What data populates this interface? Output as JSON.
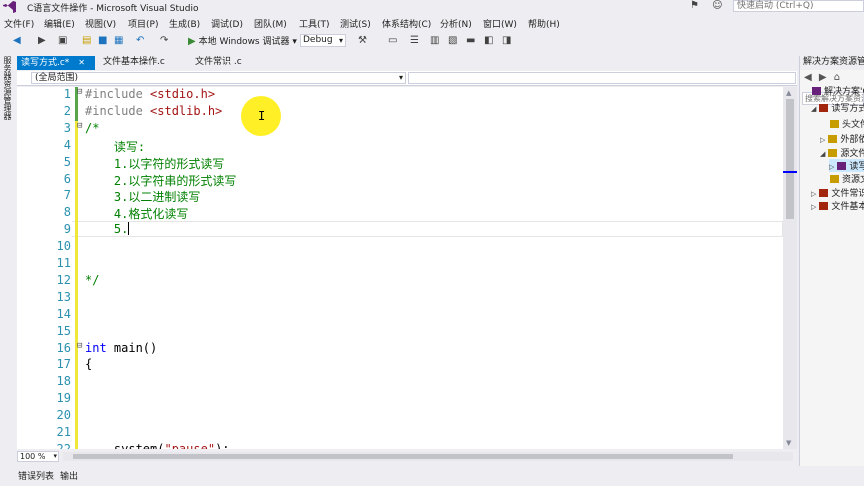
{
  "window": {
    "title": "C语言文件操作 - Microsoft Visual Studio",
    "quick_launch_placeholder": "快速启动 (Ctrl+Q)"
  },
  "menu": [
    "文件(F)",
    "编辑(E)",
    "视图(V)",
    "项目(P)",
    "生成(B)",
    "调试(D)",
    "团队(M)",
    "工具(T)",
    "测试(S)",
    "体系结构(C)",
    "分析(N)",
    "窗口(W)",
    "帮助(H)"
  ],
  "toolbar": {
    "run_label": "本地 Windows 调试器",
    "configuration": "Debug"
  },
  "left_toolwindow": "服务器资源管理器",
  "tabs": [
    {
      "label": "读写方式.c*",
      "active": true
    },
    {
      "label": "文件基本操作.c",
      "active": false
    },
    {
      "label": "文件常识 .c",
      "active": false
    }
  ],
  "nav": {
    "scope": "(全局范围)"
  },
  "editor": {
    "lines": [
      {
        "n": "1",
        "parts": [
          {
            "c": "pp",
            "t": "#include "
          },
          {
            "c": "inc",
            "t": "<stdio.h>"
          }
        ]
      },
      {
        "n": "2",
        "parts": [
          {
            "c": "pp",
            "t": "#include "
          },
          {
            "c": "inc",
            "t": "<stdlib.h>"
          }
        ]
      },
      {
        "n": "3",
        "parts": [
          {
            "c": "cm",
            "t": "/*"
          }
        ]
      },
      {
        "n": "4",
        "parts": [
          {
            "c": "cm",
            "t": "    读写:"
          }
        ]
      },
      {
        "n": "5",
        "parts": [
          {
            "c": "cm",
            "t": "    1.以字符的形式读写"
          }
        ]
      },
      {
        "n": "6",
        "parts": [
          {
            "c": "cm",
            "t": "    2.以字符串的形式读写"
          }
        ]
      },
      {
        "n": "7",
        "parts": [
          {
            "c": "cm",
            "t": "    3.以二进制读写"
          }
        ]
      },
      {
        "n": "8",
        "parts": [
          {
            "c": "cm",
            "t": "    4.格式化读写"
          }
        ]
      },
      {
        "n": "9",
        "parts": [
          {
            "c": "cm",
            "t": "    5."
          }
        ]
      },
      {
        "n": "10",
        "parts": []
      },
      {
        "n": "11",
        "parts": []
      },
      {
        "n": "12",
        "parts": [
          {
            "c": "cm",
            "t": "*/"
          }
        ]
      },
      {
        "n": "13",
        "parts": []
      },
      {
        "n": "14",
        "parts": []
      },
      {
        "n": "15",
        "parts": []
      },
      {
        "n": "16",
        "parts": [
          {
            "c": "kw",
            "t": "int"
          },
          {
            "c": "tx",
            "t": " main()"
          }
        ]
      },
      {
        "n": "17",
        "parts": [
          {
            "c": "tx",
            "t": "{"
          }
        ]
      },
      {
        "n": "18",
        "parts": []
      },
      {
        "n": "19",
        "parts": []
      },
      {
        "n": "20",
        "parts": []
      },
      {
        "n": "21",
        "parts": []
      },
      {
        "n": "22",
        "parts": [
          {
            "c": "tx",
            "t": "    system("
          },
          {
            "c": "str",
            "t": "\"pause\""
          },
          {
            "c": "tx",
            "t": ");"
          }
        ]
      }
    ],
    "zoom": "100 %"
  },
  "bottom_tabs": [
    "错误列表",
    "输出"
  ],
  "solution_explorer": {
    "title": "解决方案资源管理器",
    "search_placeholder": "搜索解决方案资源管理器",
    "items": [
      {
        "label": "解决方案'C语言文件操作'",
        "indent": 0,
        "arrow": ""
      },
      {
        "label": "读写方式",
        "indent": 1,
        "arrow": "◢"
      },
      {
        "label": "头文件",
        "indent": 2,
        "arrow": ""
      },
      {
        "label": "外部依赖项",
        "indent": 2,
        "arrow": "▷"
      },
      {
        "label": "源文件",
        "indent": 2,
        "arrow": "◢"
      },
      {
        "label": "读写方式.c",
        "indent": 3,
        "arrow": "▷"
      },
      {
        "label": "资源文件",
        "indent": 2,
        "arrow": ""
      },
      {
        "label": "文件常识",
        "indent": 1,
        "arrow": "▷"
      },
      {
        "label": "文件基本操作",
        "indent": 1,
        "arrow": "▷"
      }
    ]
  },
  "colors": {
    "accent": "#007acc",
    "comment": "#008000",
    "keyword": "#0000ff",
    "string": "#a31515",
    "line_number": "#2b91af",
    "change_saved": "#57a64a",
    "change_unsaved": "#efe839"
  }
}
